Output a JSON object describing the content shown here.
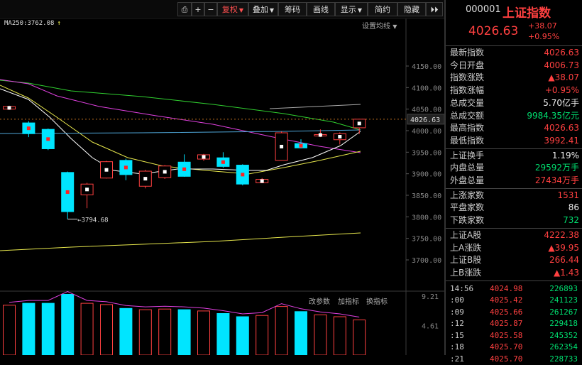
{
  "toolbar": {
    "buttons": [
      {
        "label": "⎙"
      },
      {
        "label": "+"
      },
      {
        "label": "−"
      },
      {
        "label": "复权"
      },
      {
        "label": "叠加"
      },
      {
        "label": "筹码"
      },
      {
        "label": "画线"
      },
      {
        "label": "显示"
      },
      {
        "label": "简约"
      },
      {
        "label": "隐藏"
      },
      {
        "label": "⏵⏵"
      }
    ]
  },
  "ma_legend": {
    "text": "MA250:3762.08",
    "arrow": "↑"
  },
  "settings_ma": "设置均线",
  "y_ticks": [
    "4150.00",
    "4100.00",
    "4050.00",
    "4000.00",
    "3950.00",
    "3900.00",
    "3850.00",
    "3800.00",
    "3750.00",
    "3700.00"
  ],
  "current_price_label": "4026.63",
  "low_annotation": "3794.68",
  "vol_tools": {
    "params": "改参数",
    "add": "加指标",
    "swap": "换指标"
  },
  "vol_ticks": [
    "9.21",
    "4.61"
  ],
  "colors": {
    "up": "#ff4040",
    "down": "#00e5ff",
    "ma5": "#ffffff",
    "ma10": "#e6e64c",
    "ma20": "#e040e0",
    "ma60": "#30d030",
    "ma250": "#e6e64c"
  },
  "chart_data": {
    "type": "candlestick",
    "ylim": [
      3670,
      4180
    ],
    "candles": [
      {
        "open": 4050,
        "close": 4056,
        "high": 4058,
        "low": 4048
      },
      {
        "open": 4018,
        "close": 3993,
        "high": 4022,
        "low": 3985
      },
      {
        "open": 4003,
        "close": 3958,
        "high": 4005,
        "low": 3955
      },
      {
        "open": 3903,
        "close": 3812,
        "high": 3905,
        "low": 3794.68
      },
      {
        "open": 3851,
        "close": 3876,
        "high": 3879,
        "low": 3820
      },
      {
        "open": 3890,
        "close": 3928,
        "high": 3930,
        "low": 3889
      },
      {
        "open": 3931,
        "close": 3898,
        "high": 3935,
        "low": 3885
      },
      {
        "open": 3871,
        "close": 3906,
        "high": 3909,
        "low": 3866
      },
      {
        "open": 3891,
        "close": 3918,
        "high": 3920,
        "low": 3888
      },
      {
        "open": 3927,
        "close": 3894,
        "high": 3945,
        "low": 3893
      },
      {
        "open": 3934,
        "close": 3944,
        "high": 3946,
        "low": 3930
      },
      {
        "open": 3937,
        "close": 3917,
        "high": 3950,
        "low": 3914
      },
      {
        "open": 3920,
        "close": 3876,
        "high": 3922,
        "low": 3873
      },
      {
        "open": 3879,
        "close": 3887,
        "high": 3890,
        "low": 3878
      },
      {
        "open": 3931,
        "close": 3995,
        "high": 3998,
        "low": 3931
      },
      {
        "open": 3970,
        "close": 3960,
        "high": 3980,
        "low": 3959
      },
      {
        "open": 3989,
        "close": 3991,
        "high": 4003,
        "low": 3985
      },
      {
        "open": 3979,
        "close": 3993,
        "high": 3996,
        "low": 3968
      },
      {
        "open": 4006.73,
        "close": 4026.63,
        "high": 4026.63,
        "low": 3992.41
      }
    ],
    "volume": [
      {
        "v": 7.8,
        "up": true
      },
      {
        "v": 8.1,
        "up": false
      },
      {
        "v": 8.1,
        "up": false
      },
      {
        "v": 9.5,
        "up": false
      },
      {
        "v": 8.1,
        "up": true
      },
      {
        "v": 7.9,
        "up": true
      },
      {
        "v": 7.3,
        "up": false
      },
      {
        "v": 7.1,
        "up": true
      },
      {
        "v": 7.2,
        "up": true
      },
      {
        "v": 7.1,
        "up": false
      },
      {
        "v": 6.9,
        "up": true
      },
      {
        "v": 6.5,
        "up": false
      },
      {
        "v": 6.0,
        "up": false
      },
      {
        "v": 6.2,
        "up": true
      },
      {
        "v": 7.6,
        "up": true
      },
      {
        "v": 6.8,
        "up": false
      },
      {
        "v": 6.3,
        "up": true
      },
      {
        "v": 6.0,
        "up": true
      },
      {
        "v": 5.5,
        "up": true
      }
    ],
    "vol_ylim": [
      0,
      10
    ]
  },
  "panel": {
    "code": "000001",
    "name": "上证指数",
    "price": "4026.63",
    "change": "+38.07",
    "change_pct": "+0.95%",
    "stats1": [
      {
        "label": "最新指数",
        "value": "4026.63",
        "cls": "red"
      },
      {
        "label": "今日开盘",
        "value": "4006.73",
        "cls": "red"
      },
      {
        "label": "指数涨跌",
        "value": "▲38.07",
        "cls": "red"
      },
      {
        "label": "指数涨幅",
        "value": "+0.95%",
        "cls": "red"
      },
      {
        "label": "总成交量",
        "value": "5.70亿手",
        "cls": "white"
      },
      {
        "label": "总成交额",
        "value": "9984.35亿元",
        "cls": "green"
      },
      {
        "label": "最高指数",
        "value": "4026.63",
        "cls": "red"
      },
      {
        "label": "最低指数",
        "value": "3992.41",
        "cls": "red"
      }
    ],
    "stats2": [
      {
        "label": "上证换手",
        "value": "1.19%",
        "cls": "white"
      },
      {
        "label": "内盘总量",
        "value": "29592万手",
        "cls": "green"
      },
      {
        "label": "外盘总量",
        "value": "27434万手",
        "cls": "red"
      }
    ],
    "stats3": [
      {
        "label": "上涨家数",
        "value": "1531",
        "cls": "red"
      },
      {
        "label": "平盘家数",
        "value": "86",
        "cls": "white"
      },
      {
        "label": "下跌家数",
        "value": "732",
        "cls": "green"
      }
    ],
    "stats4": [
      {
        "label": "上证A股",
        "value": "4222.38",
        "cls": "red"
      },
      {
        "label": "上A涨跌",
        "value": "▲39.95",
        "cls": "red"
      },
      {
        "label": "上证B股",
        "value": "266.44",
        "cls": "red"
      },
      {
        "label": "上B涨跌",
        "value": "▲1.43",
        "cls": "red"
      }
    ],
    "ticks": [
      {
        "time": "14:56",
        "price": "4024.98",
        "vol": "226893"
      },
      {
        "time": ":00",
        "price": "4025.42",
        "vol": "241123"
      },
      {
        "time": ":09",
        "price": "4025.66",
        "vol": "261267"
      },
      {
        "time": ":12",
        "price": "4025.87",
        "vol": "229418"
      },
      {
        "time": ":15",
        "price": "4025.58",
        "vol": "245352"
      },
      {
        "time": ":18",
        "price": "4025.70",
        "vol": "262354"
      },
      {
        "time": ":21",
        "price": "4025.70",
        "vol": "228733"
      }
    ]
  }
}
